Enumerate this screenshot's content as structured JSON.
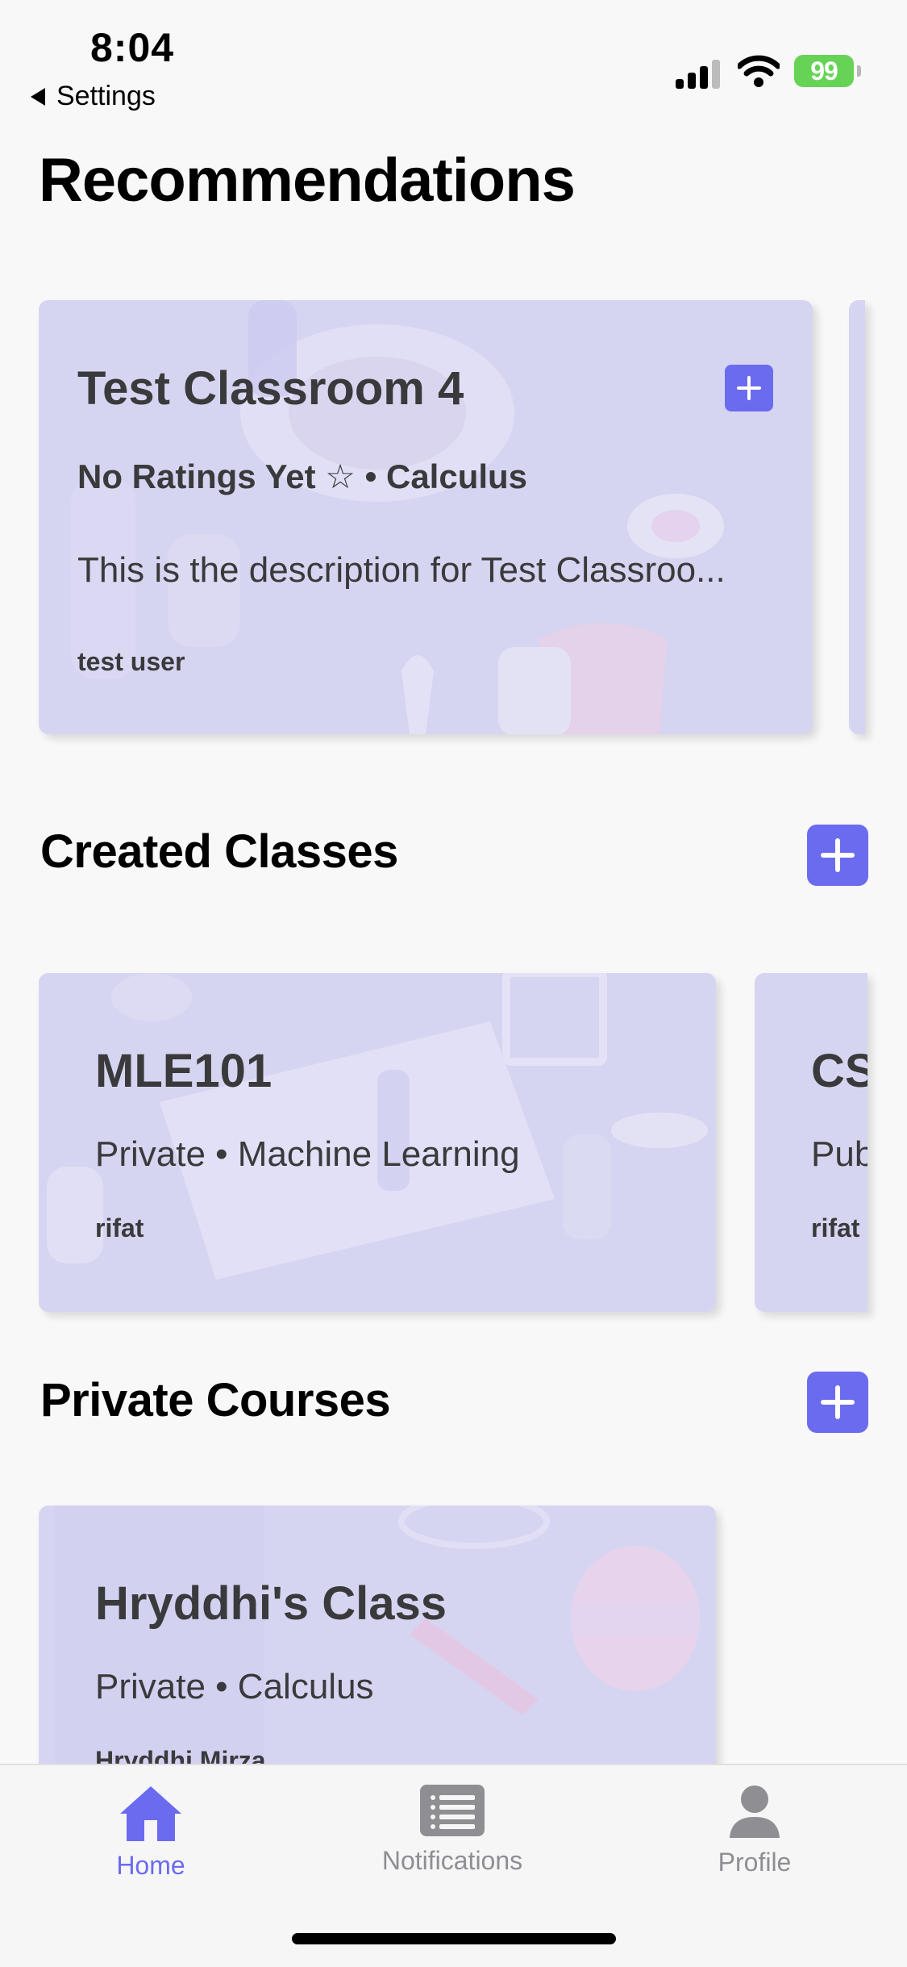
{
  "status_bar": {
    "time": "8:04",
    "back_label": "Settings",
    "battery": "99"
  },
  "page_title": "Recommendations",
  "recommendations": [
    {
      "title": "Test Classroom 4",
      "meta": "No Ratings Yet ☆ • Calculus",
      "description": "This is the description for Test Classroo...",
      "owner": "test user"
    }
  ],
  "created_classes": {
    "title": "Created Classes",
    "items": [
      {
        "title": "MLE101",
        "meta": "Private • Machine Learning",
        "owner": "rifat"
      },
      {
        "title": "CS",
        "meta": "Pub",
        "owner": "rifat"
      }
    ]
  },
  "private_courses": {
    "title": "Private Courses",
    "items": [
      {
        "title": "Hryddhi's Class",
        "meta": "Private • Calculus",
        "owner": "Hryddhi Mirza"
      }
    ]
  },
  "tabbar": {
    "items": [
      {
        "label": "Home",
        "icon": "home-icon",
        "active": true
      },
      {
        "label": "Notifications",
        "icon": "list-icon",
        "active": false
      },
      {
        "label": "Profile",
        "icon": "person-icon",
        "active": false
      }
    ]
  },
  "colors": {
    "accent": "#6b6bef",
    "card": "#d6d5f1",
    "background": "#f8f8f8"
  }
}
